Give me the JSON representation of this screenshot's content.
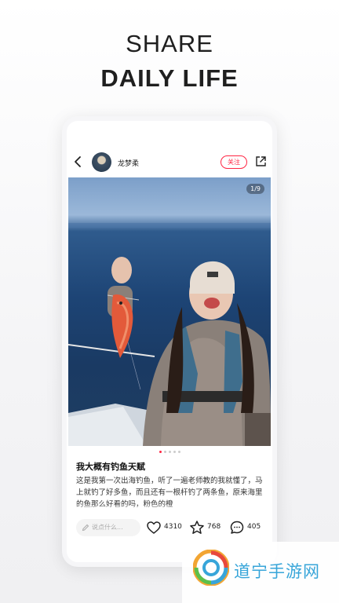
{
  "promo": {
    "line1": "SHARE",
    "line2": "DAILY LIFE"
  },
  "header": {
    "username": "龙梦柔",
    "follow_label": "关注"
  },
  "photo": {
    "counter": "1/9",
    "total_dots": 5,
    "active_dot": 0
  },
  "post": {
    "title": "我大概有钓鱼天赋",
    "body": "这是我第一次出海钓鱼，听了一遍老师教的我就懂了，马上就钓了好多鱼，而且还有一根杆钓了两条鱼，原来海里的鱼那么好看的吗，粉色的橙"
  },
  "actions": {
    "comment_placeholder": "说点什么...",
    "likes": "4310",
    "collects": "768",
    "comments": "405"
  },
  "icons": {
    "back": "back-chevron-icon",
    "share": "share-icon",
    "pencil": "pencil-icon",
    "like": "heart-icon",
    "collect": "star-icon",
    "comment": "comment-icon",
    "watermark_logo": "swirl-logo"
  },
  "colors": {
    "accent": "#ff2442",
    "watermark": "#37a5d9"
  },
  "watermark": {
    "text": "道宁手游网"
  }
}
